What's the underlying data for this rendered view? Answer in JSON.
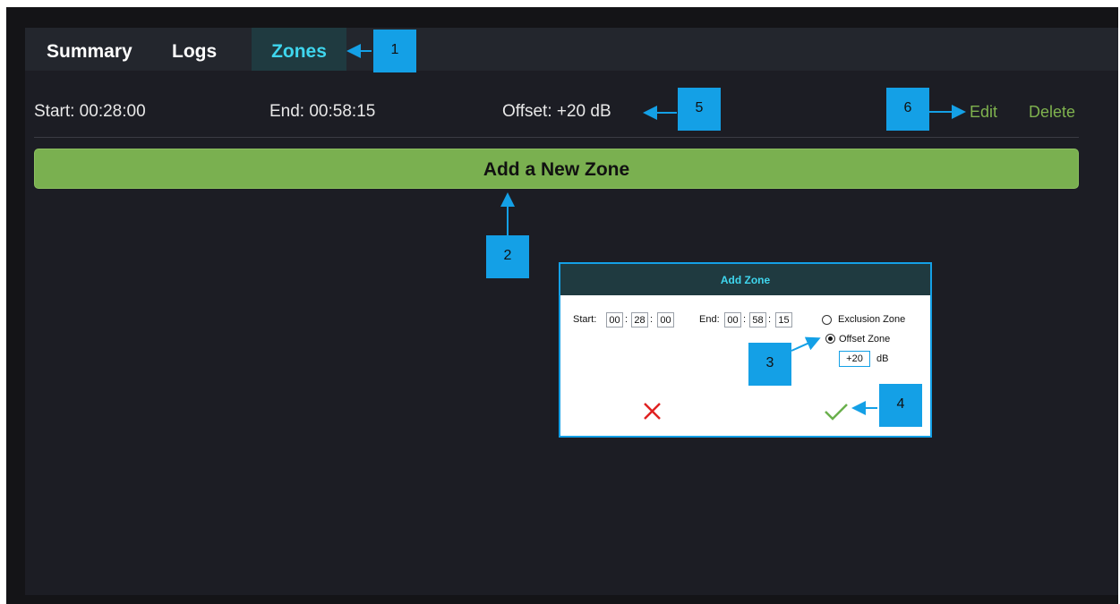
{
  "tabs": [
    {
      "label": "Summary",
      "active": false
    },
    {
      "label": "Logs",
      "active": false
    },
    {
      "label": "Zones",
      "active": true
    }
  ],
  "zone": {
    "start": "Start: 00:28:00",
    "end": "End: 00:58:15",
    "offset": "Offset: +20 dB",
    "edit_label": "Edit",
    "delete_label": "Delete"
  },
  "add_button_label": "Add a New Zone",
  "dialog": {
    "title": "Add Zone",
    "start_label": "Start:",
    "start": [
      "00",
      "28",
      "00"
    ],
    "end_label": "End:",
    "end": [
      "00",
      "58",
      "15"
    ],
    "separator": ":",
    "options": [
      {
        "label": "Exclusion Zone",
        "selected": false
      },
      {
        "label": "Offset Zone",
        "selected": true
      }
    ],
    "offset_value": "+20",
    "offset_unit": "dB",
    "cancel_icon": "x-icon",
    "confirm_icon": "checkmark-icon"
  },
  "callouts": [
    "1",
    "2",
    "3",
    "4",
    "5",
    "6"
  ],
  "colors": {
    "accent": "#3fd6ee",
    "add_button": "#7ab050",
    "link": "#7fb24e",
    "callout": "#14a0e6",
    "cancel": "#e02020",
    "confirm": "#6ab04c",
    "background": "#1c1d24"
  }
}
